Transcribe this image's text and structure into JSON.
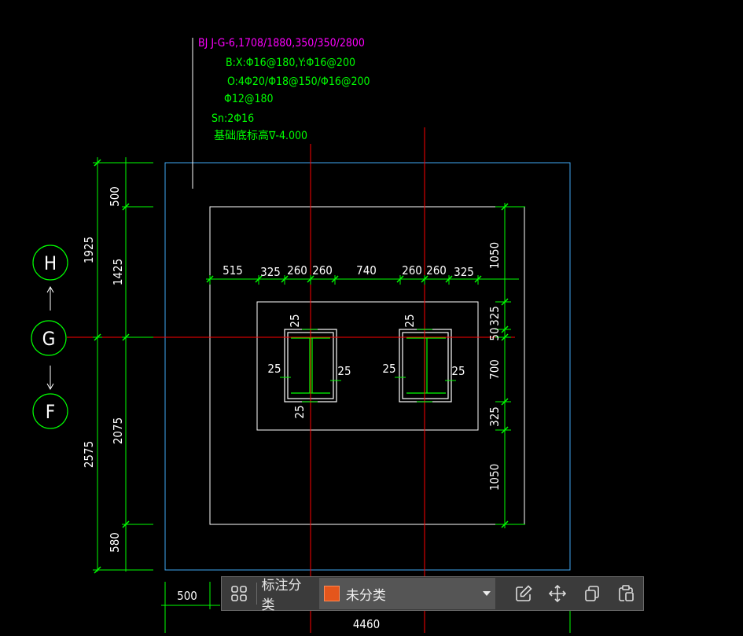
{
  "annotation": {
    "line1": "BJ J-G-6,1708/1880,350/350/2800",
    "line2": "B:X:Φ16@180,Y:Φ16@200",
    "line3": "O:4Φ20/Φ18@150/Φ16@200",
    "line4": "Φ12@180",
    "line5": "Sn:2Φ16",
    "line6": "基础底标高∇-4.000"
  },
  "axes": {
    "h": "H",
    "g": "G",
    "f": "F"
  },
  "dims": {
    "left_500": "500",
    "left_1425": "1425",
    "left_1925": "1925",
    "left_2075": "2075",
    "left_580": "580",
    "left_2575": "2575",
    "top_515": "515",
    "top_325a": "325",
    "top_260a": "260",
    "top_260b": "260",
    "top_740": "740",
    "top_260c": "260",
    "top_260d": "260",
    "top_325b": "325",
    "right_1050a": "1050",
    "right_325a": "325",
    "right_50": "50",
    "right_700": "700",
    "right_325b": "325",
    "right_1050b": "1050",
    "c1_top": "25",
    "c1_left": "25",
    "c1_right": "25",
    "c1_bottom": "25",
    "c2_top": "25",
    "c2_left": "25",
    "c2_right": "25",
    "bottom_500": "500",
    "bottom_4460": "4460"
  },
  "toolbar": {
    "category_label": "标注分类",
    "selected_category": "未分类",
    "swatch_color": "#e4561c"
  },
  "colors": {
    "dimension": "#00ff00",
    "annotation_magenta": "#ff00ff",
    "axis_red": "#ff0000",
    "outline_white": "#ffffff",
    "boundary_blue": "#3fa9f5"
  }
}
